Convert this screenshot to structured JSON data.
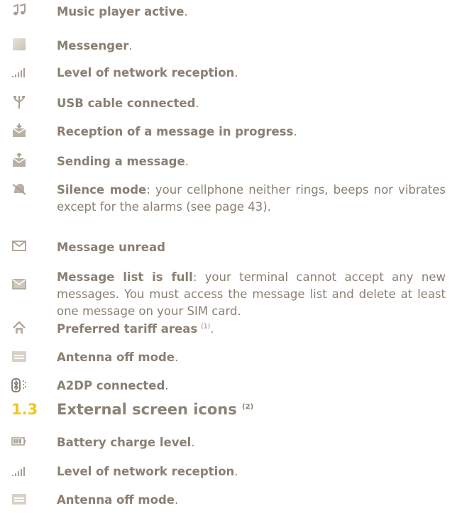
{
  "items": [
    {
      "icon": "music-note-icon",
      "bold": "Music player active",
      "rest": "."
    },
    {
      "icon": "messenger-icon",
      "bold": "Messenger",
      "rest": "."
    },
    {
      "icon": "signal-bars-icon",
      "bold": "Level of network reception",
      "rest": "."
    },
    {
      "icon": "usb-icon",
      "bold": "USB cable connected",
      "rest": "."
    },
    {
      "icon": "envelope-receive-icon",
      "bold": "Reception of a message in progress",
      "rest": "."
    },
    {
      "icon": "envelope-send-icon",
      "bold": "Sending a message",
      "rest": "."
    },
    {
      "icon": "silence-mode-icon",
      "bold": "Silence mode",
      "rest": ": your cellphone neither rings, beeps nor vibrates except for the alarms (see page 43)."
    },
    {
      "icon": "envelope-unread-icon",
      "bold": "Message unread",
      "rest": ""
    },
    {
      "icon": "envelope-full-icon",
      "bold": "Message list is full",
      "rest": ": your terminal cannot accept any new messages. You must access the message list and delete at least one message on your SIM card."
    },
    {
      "icon": "home-icon",
      "bold": "Preferred tariff areas",
      "sup": "(1)",
      "rest": "."
    },
    {
      "icon": "antenna-off-icon",
      "bold": "Antenna off mode",
      "rest": "."
    },
    {
      "icon": "bluetooth-a2dp-icon",
      "bold": "A2DP connected",
      "rest": "."
    }
  ],
  "section": {
    "number": "1.3",
    "title": "External screen icons",
    "sup": "(2)"
  },
  "external_items": [
    {
      "icon": "battery-icon",
      "bold": "Battery charge level",
      "rest": "."
    },
    {
      "icon": "signal-bars-icon",
      "bold": "Level of network reception",
      "rest": "."
    },
    {
      "icon": "antenna-off-icon",
      "bold": "Antenna off mode",
      "rest": "."
    }
  ],
  "colors": {
    "text": "#8a7f72",
    "accent": "#f2c51c",
    "icon": "#a89f92"
  }
}
